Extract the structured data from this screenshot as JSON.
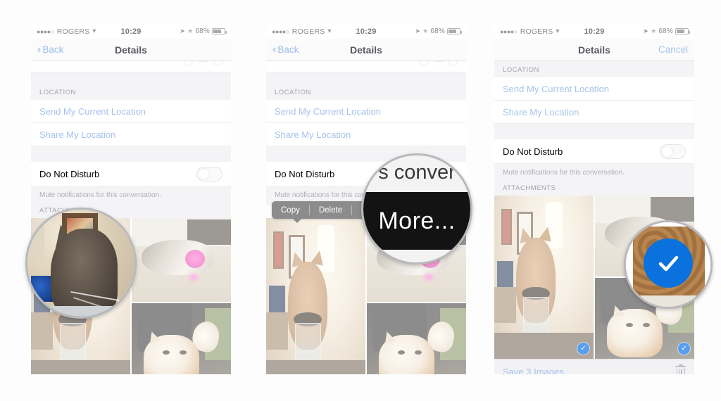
{
  "meta": {
    "scene": "iPhone Messages Details screen — saving attachment images (3 steps)"
  },
  "status_bar": {
    "signal_dots": "●●●●○",
    "carrier": "ROGERS",
    "wifi_icon": "wifi-icon",
    "time": "10:29",
    "location_icon": "location-arrow-icon",
    "bluetooth_icon": "bluetooth-icon",
    "battery_percent": "68%",
    "battery_icon": "battery-icon"
  },
  "panels": [
    {
      "id": "panel-1",
      "nav": {
        "back_label": "Back",
        "title": "Details",
        "right_label": ""
      },
      "section_header": "LOCATION",
      "rows": [
        {
          "label": "Send My Current Location",
          "style": "link"
        },
        {
          "label": "Share My Location",
          "style": "link"
        }
      ],
      "toggle_row": {
        "label": "Do Not Disturb",
        "state": "off"
      },
      "footnote": "Mute notifications for this conversation.",
      "attachments_header": "ATTACHMENTS",
      "photos": [
        {
          "name": "cat-in-glass-photo",
          "selected": false
        },
        {
          "name": "cat-pink-nose-photo",
          "selected": false
        },
        {
          "name": "calico-cat-paw-photo",
          "selected": false
        }
      ]
    },
    {
      "id": "panel-2",
      "nav": {
        "back_label": "Back",
        "title": "Details",
        "right_label": ""
      },
      "section_header": "LOCATION",
      "rows": [
        {
          "label": "Send My Current Location",
          "style": "link"
        },
        {
          "label": "Share My Location",
          "style": "link"
        }
      ],
      "toggle_row": {
        "label": "Do Not Disturb",
        "state": "off"
      },
      "footnote": "Mute notifications for this conversation.",
      "context_menu": {
        "items": [
          "Copy",
          "Delete",
          "More..."
        ],
        "truncated_third": "M"
      },
      "photos": [
        {
          "name": "cat-in-glass-photo",
          "selected": false
        },
        {
          "name": "cat-pink-nose-photo",
          "selected": false
        },
        {
          "name": "calico-cat-paw-photo",
          "selected": false
        }
      ]
    },
    {
      "id": "panel-3",
      "nav": {
        "back_label": "",
        "title": "Details",
        "right_label": "Cancel"
      },
      "section_header": "LOCATION",
      "rows": [
        {
          "label": "Send My Current Location",
          "style": "link"
        },
        {
          "label": "Share My Location",
          "style": "link"
        }
      ],
      "toggle_row": {
        "label": "Do Not Disturb",
        "state": "off"
      },
      "footnote": "Mute notifications for this conversation.",
      "attachments_header": "ATTACHMENTS",
      "photos": [
        {
          "name": "cat-in-glass-photo",
          "selected": true
        },
        {
          "name": "cat-pink-nose-photo",
          "selected": true
        },
        {
          "name": "calico-cat-paw-photo",
          "selected": true
        }
      ],
      "save_bar": {
        "label": "Save 3 Images",
        "trash_icon": "trash-icon"
      }
    }
  ],
  "loupes": [
    {
      "id": "loupe-1",
      "name": "magnifier-cat-photo",
      "content": ""
    },
    {
      "id": "loupe-2",
      "name": "magnifier-more-menu",
      "top_text": "s conver",
      "label": "More..."
    },
    {
      "id": "loupe-3",
      "name": "magnifier-selected-checkmark",
      "content": ""
    }
  ],
  "colors": {
    "link_blue": "#a6c3ec",
    "accent_blue": "#0b72dd",
    "check_blue": "#5a9ef0",
    "menu_gray": "#8c8c8c",
    "section_bg": "#f4f4f6"
  }
}
